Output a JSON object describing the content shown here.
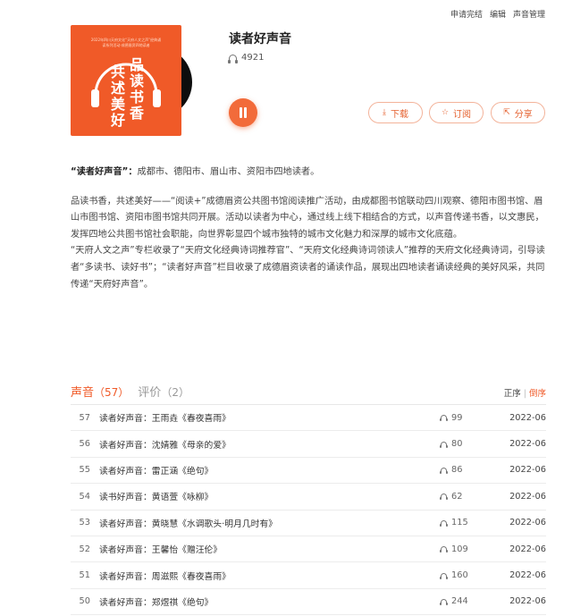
{
  "toplinks": [
    "申请完结",
    "编辑",
    "声音管理"
  ],
  "album": {
    "title": "读者好声音",
    "play_count": "4921",
    "cover_small_text": "2022年四川天府文化“天府人文之声”经典诵读系列活动·成德眉资四地读者",
    "cover_text_col1": "共述美好",
    "cover_text_col2": "品读书香",
    "buttons": {
      "download": "下载",
      "subscribe": "订阅",
      "share": "分享"
    }
  },
  "description": {
    "lead_bold": "“读者好声音”：",
    "lead_rest": "成都市、德阳市、眉山市、资阳市四地读者。",
    "para1": "品读书香，共述美好——“阅读+”成德眉资公共图书馆阅读推广活动，由成都图书馆联动四川观察、德阳市图书馆、眉山市图书馆、资阳市图书馆共同开展。活动以读者为中心，通过线上线下相结合的方式，以声音传递书香，以文惠民，发挥四地公共图书馆社会职能，向世界彰显四个城市独特的城市文化魅力和深厚的城市文化底蕴。",
    "para2": "“天府人文之声”专栏收录了“天府文化经典诗词推荐官”、“天府文化经典诗词领读人”推荐的天府文化经典诗词，引导读者“多读书、读好书”；“读者好声音”栏目收录了成德眉资读者的诵读作品，展现出四地读者诵读经典的美好风采，共同传递“天府好声音”。"
  },
  "tabs": {
    "sound_label": "声音",
    "sound_count": "（57）",
    "review_label": "评价",
    "review_count": "（2）",
    "sort_asc": "正序",
    "sort_sep": "|",
    "sort_desc": "倒序"
  },
  "tracks": [
    {
      "num": "57",
      "title": "读者好声音：王雨垚《春夜喜雨》",
      "plays": "99",
      "date": "2022-06"
    },
    {
      "num": "56",
      "title": "读者好声音：沈婧雅《母亲的爱》",
      "plays": "80",
      "date": "2022-06"
    },
    {
      "num": "55",
      "title": "读者好声音：雷正涵《绝句》",
      "plays": "86",
      "date": "2022-06"
    },
    {
      "num": "54",
      "title": "读书好声音：黄语萱《咏柳》",
      "plays": "62",
      "date": "2022-06"
    },
    {
      "num": "53",
      "title": "读者好声音：黄晓慧《水调歌头·明月几时有》",
      "plays": "115",
      "date": "2022-06"
    },
    {
      "num": "52",
      "title": "读者好声音：王馨怡《赠汪伦》",
      "plays": "109",
      "date": "2022-06"
    },
    {
      "num": "51",
      "title": "读者好声音：周滋熙《春夜喜雨》",
      "plays": "160",
      "date": "2022-06"
    },
    {
      "num": "50",
      "title": "读者好声音：郑煜祺《绝句》",
      "plays": "244",
      "date": "2022-06"
    }
  ],
  "colors": {
    "accent": "#f05a28",
    "cover_bg": "#f05a28"
  }
}
